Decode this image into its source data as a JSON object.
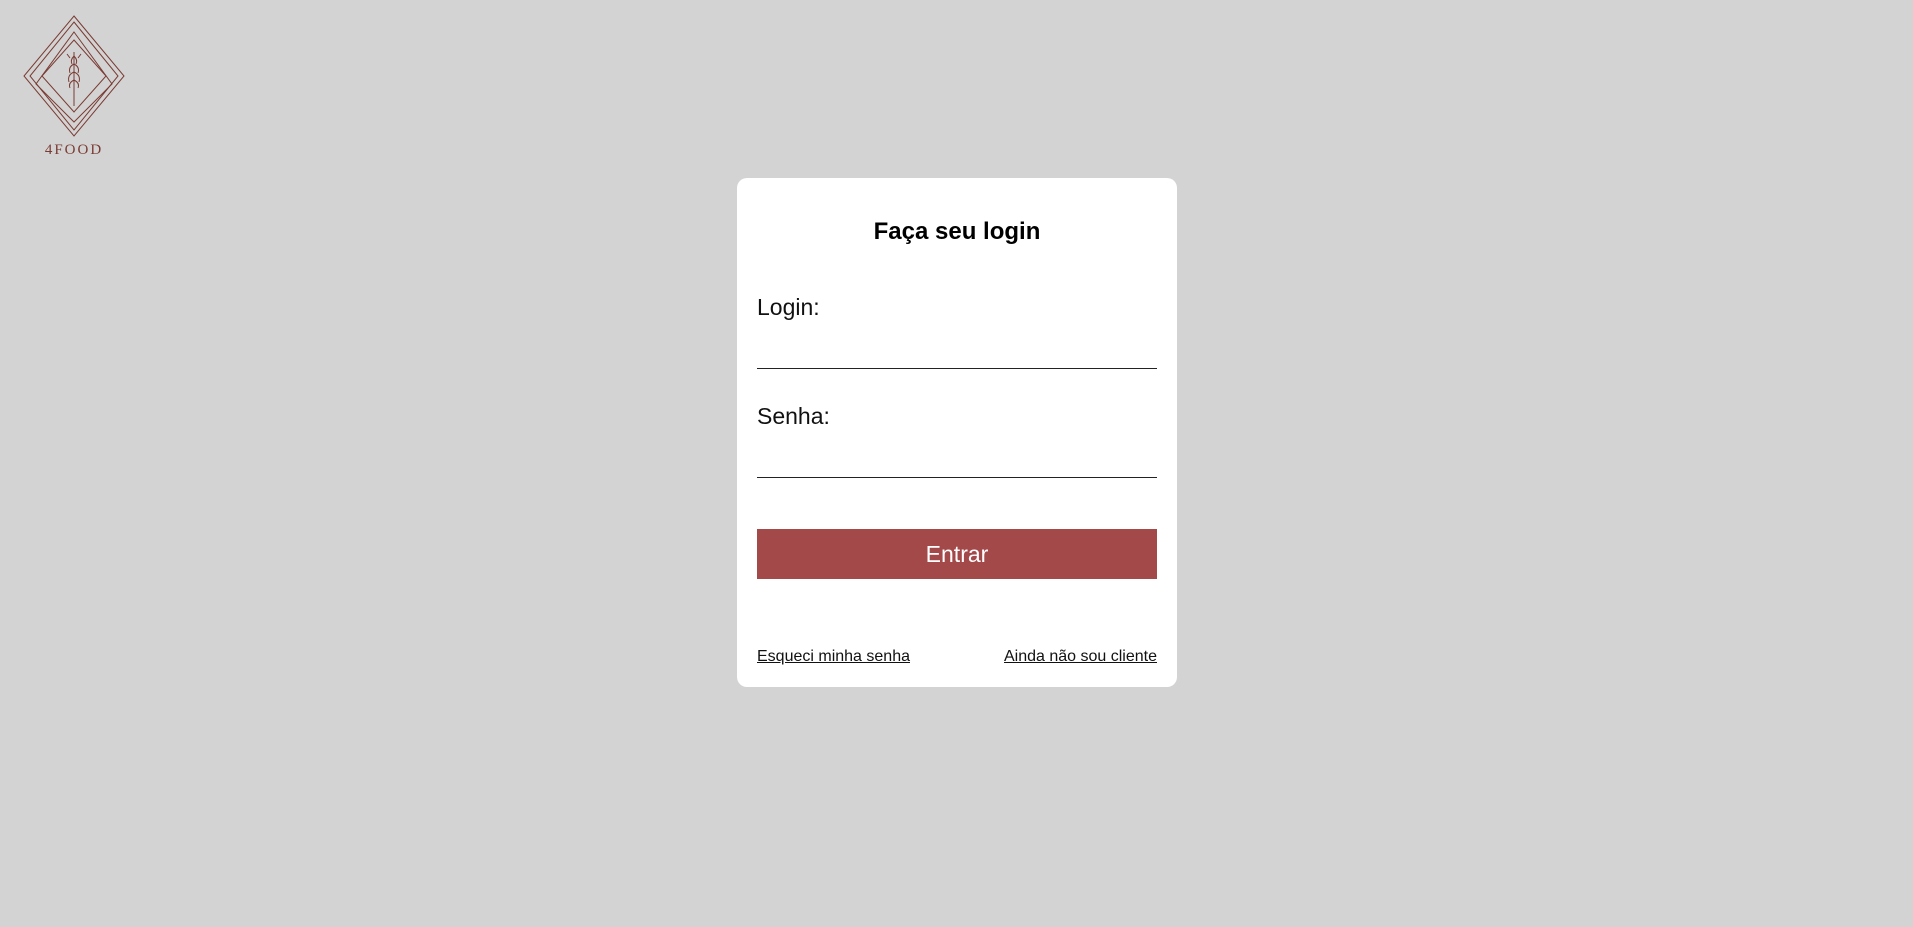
{
  "brand": {
    "name": "4FOOD",
    "logo_icon": "wheat-diamond-icon",
    "color": "#7a3b33"
  },
  "login_card": {
    "title": "Faça seu login",
    "login_label": "Login:",
    "login_value": "",
    "password_label": "Senha:",
    "password_value": "",
    "submit_label": "Entrar",
    "forgot_password_link": "Esqueci minha senha",
    "signup_link": "Ainda não sou cliente"
  },
  "colors": {
    "background": "#d3d3d3",
    "card": "#ffffff",
    "accent": "#a3494a"
  }
}
